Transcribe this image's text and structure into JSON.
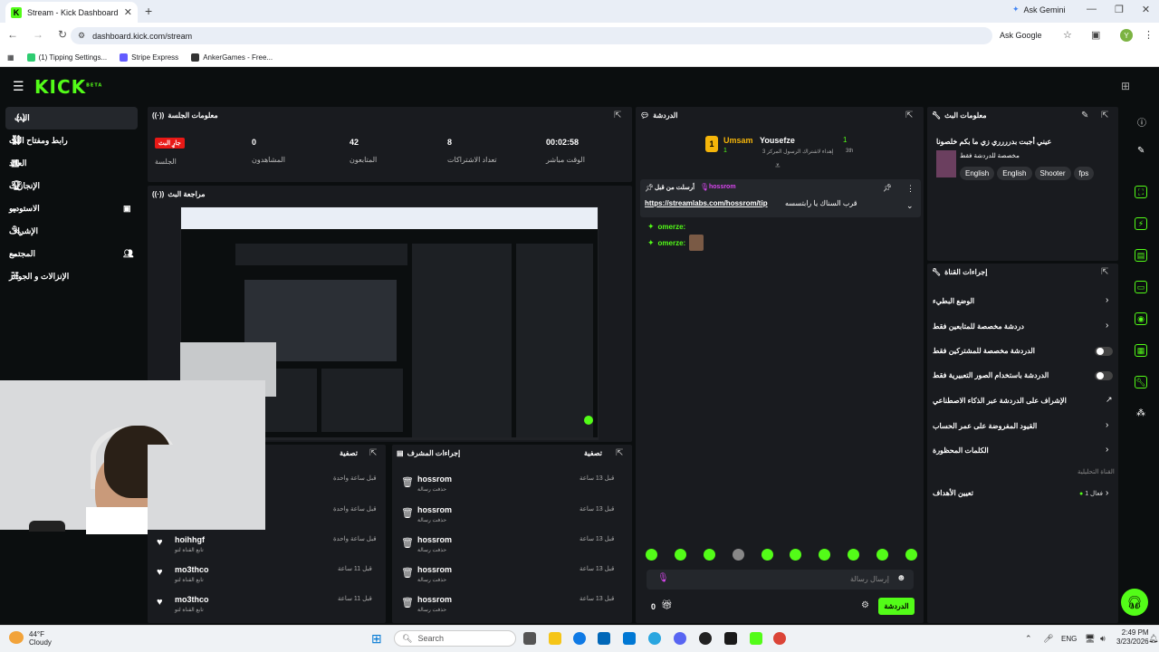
{
  "browser": {
    "tab_title": "Stream - Kick Dashboard",
    "tab_favicon": "K",
    "ask_gemini": "Ask Gemini",
    "url": "dashboard.kick.com/stream",
    "ask_google": "Ask Google",
    "avatar_letter": "Y",
    "bookmarks": [
      "(1) Tipping Settings...",
      "Stripe Express",
      "AnkerGames - Free..."
    ]
  },
  "logo": "KICK",
  "logo_sup": "BETA",
  "sidebar": {
    "items": [
      {
        "label": "البث"
      },
      {
        "label": "رابط ومفتاح البث"
      },
      {
        "label": "العائد"
      },
      {
        "label": "الإنجازات"
      },
      {
        "label": "الاستوديو"
      },
      {
        "label": "الإشراف"
      },
      {
        "label": "المجتمع"
      },
      {
        "label": "الإنزالات و الجوائز"
      }
    ]
  },
  "session": {
    "title": "معلومات الجلسة",
    "live_badge": "جارٍ البث",
    "live_label": "الجلسة",
    "viewers_value": "0",
    "viewers_label": "المشاهدون",
    "followers_value": "42",
    "followers_label": "المتابعون",
    "subs_value": "8",
    "subs_label": "تعداد الاشتراكات",
    "uptime_value": "00:02:58",
    "uptime_label": "الوقت مباشر"
  },
  "preview": {
    "title": "مراجعة البث"
  },
  "left_panel": {
    "title": "تصفية",
    "rows": [
      {
        "name": "",
        "sub": "",
        "time": "قبل ساعة واحدة"
      },
      {
        "name": "",
        "sub": "",
        "time": "قبل ساعة واحدة"
      },
      {
        "name": "hoihhgf",
        "sub": "تابع القناة لتو",
        "time": "قبل ساعة واحدة"
      },
      {
        "name": "mo3thco",
        "sub": "تابع القناة لتو",
        "time": "قبل 11 ساعة"
      },
      {
        "name": "mo3thco",
        "sub": "تابع القناة لتو",
        "time": "قبل 11 ساعة"
      }
    ]
  },
  "mid_panel": {
    "title": "إجراءات المشرف",
    "filter": "تصفية",
    "rows": [
      {
        "name": "hossrom",
        "sub": "حذفت رسالة",
        "time": "قبل 13 ساعة"
      },
      {
        "name": "hossrom",
        "sub": "حذفت رسالة",
        "time": "قبل 13 ساعة"
      },
      {
        "name": "hossrom",
        "sub": "حذفت رسالة",
        "time": "قبل 13 ساعة"
      },
      {
        "name": "hossrom",
        "sub": "حذفت رسالة",
        "time": "قبل 13 ساعة"
      },
      {
        "name": "hossrom",
        "sub": "حذفت رسالة",
        "time": "قبل 13 ساعة"
      }
    ]
  },
  "chat": {
    "title": "الدردشة",
    "top1_name": "Umsam",
    "top1_count": "1",
    "top2_name": "Yousefze",
    "top2_count": "1",
    "top_sub": "3 إهداء لاشتراك الرسول المركز",
    "top_sub2": "3th",
    "pinned_by": "أرسلت من قبل",
    "pinned_user": "hossrom",
    "pinned_link": "https://streamlabs.com/hossrom/tip",
    "pinned_text": "قرب السناك يا رابتسسه",
    "messages": [
      {
        "user": "omerze:"
      },
      {
        "user": "omerze:"
      }
    ],
    "input_placeholder": "إرسال رسالة",
    "count": "0",
    "send_button": "الدردشة"
  },
  "stream_info": {
    "title": "معلومات البث",
    "stream_title": "عيني أجبت بدرررري زي ما بكم خلصونا",
    "category": "مخصصة للدردشة فقط",
    "tags": [
      "English",
      "English",
      "Shooter",
      "fps"
    ]
  },
  "mod_actions": {
    "title": "إجراءات القناة",
    "rows": [
      {
        "label": "الوضع البطيء",
        "kind": "arrow"
      },
      {
        "label": "دردشة مخصصة للمتابعين فقط",
        "kind": "arrow"
      },
      {
        "label": "الدردشة مخصصة للمشتركين فقط",
        "kind": "toggle"
      },
      {
        "label": "الدردشة باستخدام الصور التعبيرية فقط",
        "kind": "toggle"
      },
      {
        "label": "الإشراف على الدردشة عبر الذكاء الاصطناعي",
        "kind": "ext"
      },
      {
        "label": "القيود المفروضة على عمر الحساب",
        "kind": "arrow"
      },
      {
        "label": "الكلمات المحظورة",
        "kind": "arrow"
      }
    ],
    "section_label": "القناة التحليلية",
    "goals_label": "تعيين الأهداف",
    "goals_status": "فعال 1"
  },
  "taskbar": {
    "temp": "44°F",
    "weather": "Cloudy",
    "search": "Search",
    "lang": "ENG",
    "time": "2:49 PM",
    "date": "3/23/2026"
  },
  "colors": {
    "brand": "#53fc18",
    "live": "#e91916",
    "panel": "#191b1f",
    "bg": "#0b0e0f"
  }
}
